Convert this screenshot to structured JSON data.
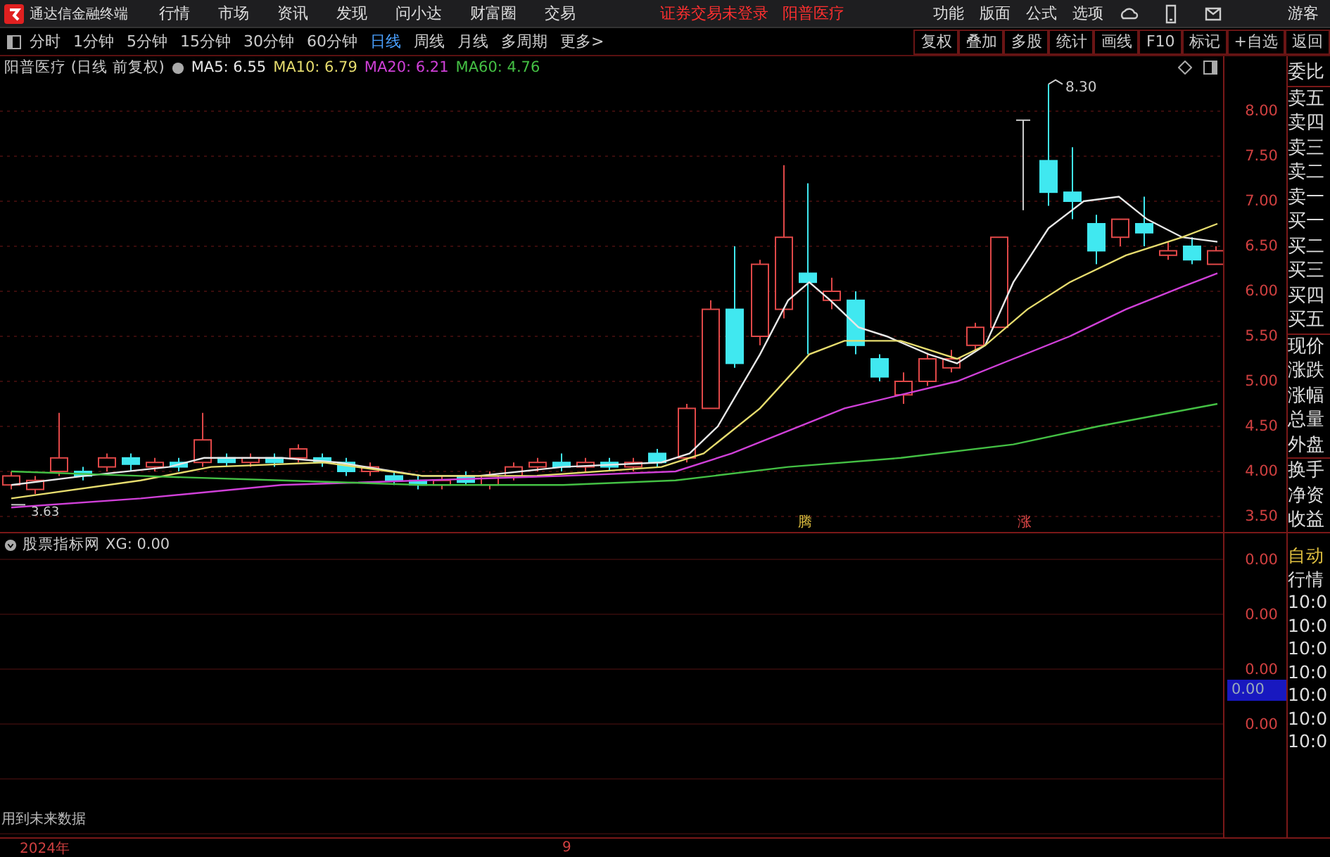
{
  "title_bar": {
    "app_name": "通达信金融终端",
    "menu": [
      "行情",
      "市场",
      "资讯",
      "发现",
      "问小达",
      "财富圈",
      "交易"
    ],
    "notices": [
      "证券交易未登录",
      "阳普医疗"
    ],
    "right_menu": [
      "功能",
      "版面",
      "公式",
      "选项"
    ],
    "user": "游客"
  },
  "toolbar": {
    "periods": [
      {
        "label": "分时",
        "selected": false
      },
      {
        "label": "1分钟",
        "selected": false
      },
      {
        "label": "5分钟",
        "selected": false
      },
      {
        "label": "15分钟",
        "selected": false
      },
      {
        "label": "30分钟",
        "selected": false
      },
      {
        "label": "60分钟",
        "selected": false
      },
      {
        "label": "日线",
        "selected": true
      },
      {
        "label": "周线",
        "selected": false
      },
      {
        "label": "月线",
        "selected": false
      },
      {
        "label": "多周期",
        "selected": false
      },
      {
        "label": "更多>",
        "selected": false
      }
    ],
    "buttons": [
      "复权",
      "叠加",
      "多股",
      "统计",
      "画线",
      "F10",
      "标记",
      "+自选",
      "返回"
    ]
  },
  "main_chart": {
    "stock": "阳普医疗",
    "mode": "(日线 前复权)",
    "indicators": [
      {
        "name": "MA5:",
        "value": "6.55",
        "color": "#e8e8e8"
      },
      {
        "name": "MA10:",
        "value": "6.79",
        "color": "#e6dc6e"
      },
      {
        "name": "MA20:",
        "value": "6.21",
        "color": "#d040d8"
      },
      {
        "name": "MA60:",
        "value": "4.76",
        "color": "#44c044"
      }
    ],
    "high_label": "8.30",
    "low_label": "3.63",
    "markers": [
      "腾",
      "涨"
    ],
    "price_ticks": [
      "8.00",
      "7.50",
      "7.00",
      "6.50",
      "6.00",
      "5.50",
      "5.00",
      "4.50",
      "4.00",
      "3.50"
    ]
  },
  "quote_column": {
    "labels": [
      "委比",
      "卖五",
      "卖四",
      "卖三",
      "卖二",
      "卖一",
      "买一",
      "买二",
      "买三",
      "买四",
      "买五",
      "现价",
      "涨跌",
      "涨幅",
      "总量",
      "外盘",
      "换手",
      "净资",
      "收益"
    ]
  },
  "indicator_panel": {
    "name": "股票指标网",
    "reading": "XG: 0.00",
    "ticks": [
      "0.00",
      "0.00",
      "0.00",
      "0.00"
    ],
    "cursor_value": "0.00",
    "note": "用到未来数据"
  },
  "lower_quote_column": {
    "labels": [
      "自动",
      "行情"
    ],
    "times": [
      "10:0",
      "10:0",
      "10:0",
      "10:0",
      "10:0",
      "10:0",
      "10:0"
    ]
  },
  "date_axis": [
    "2024年",
    "9"
  ]
}
